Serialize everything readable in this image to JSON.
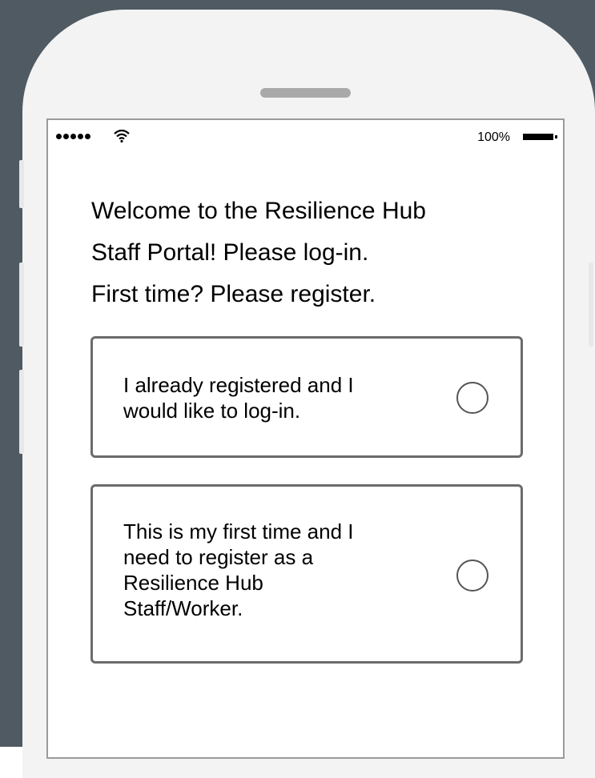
{
  "status_bar": {
    "battery_percent": "100%",
    "icons": [
      "signal-dots-icon",
      "wifi-icon",
      "battery-icon"
    ]
  },
  "welcome": {
    "lines": [
      "Welcome to the Resilience Hub",
      "Staff Portal! Please log-in.",
      "First time? Please register."
    ]
  },
  "options": [
    {
      "lines": [
        "I already registered and I",
        "would like to log-in."
      ],
      "selected": false
    },
    {
      "lines": [
        "This is my first time and I",
        "need to register as a",
        "Resilience Hub",
        "Staff/Worker."
      ],
      "selected": false
    }
  ],
  "colors": {
    "background": "#4f5a62",
    "phone_frame": "#f3f3f3",
    "screen": "#ffffff",
    "card_border": "#6b6b6b"
  }
}
